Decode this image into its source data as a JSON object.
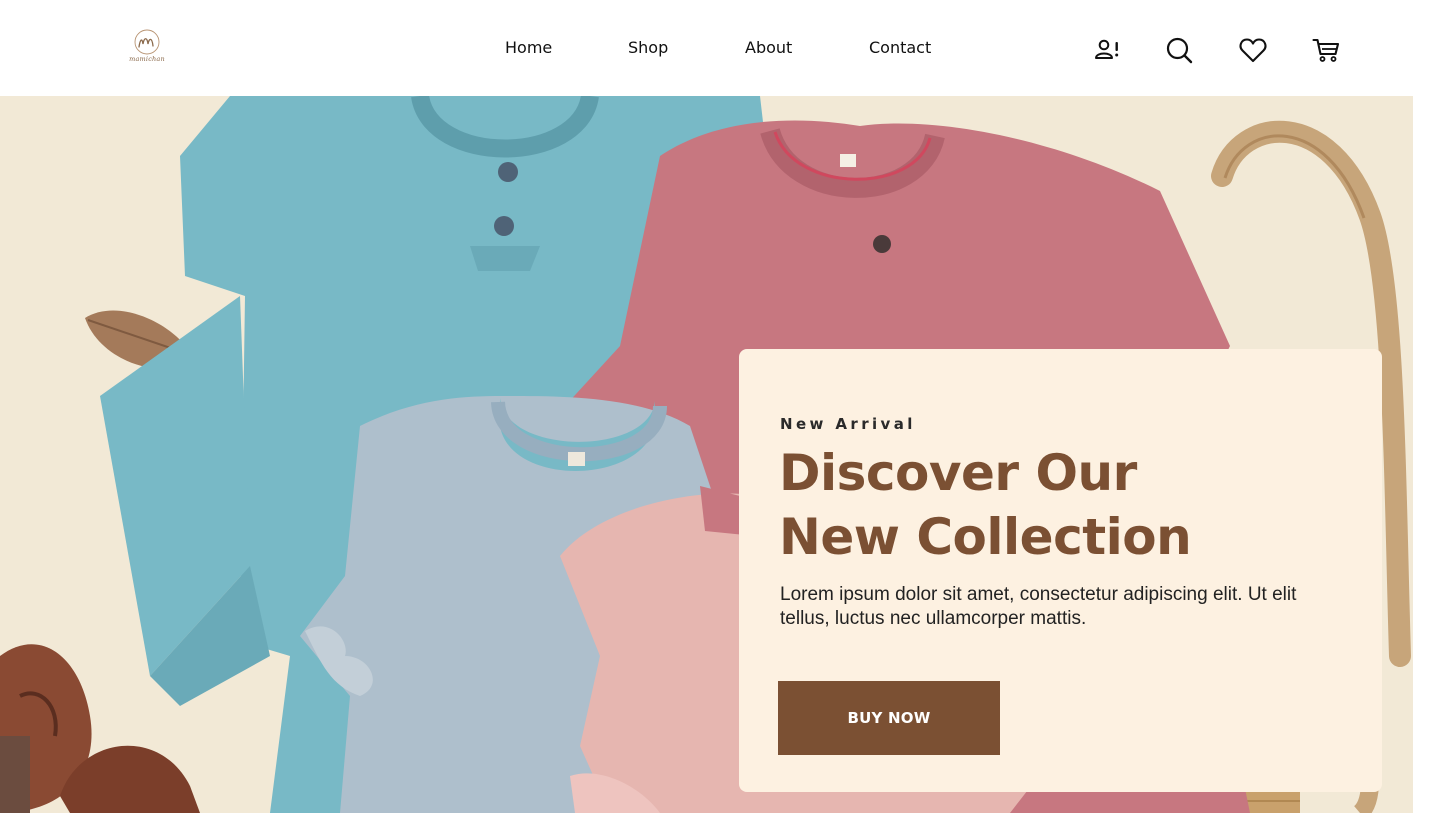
{
  "brand": {
    "logo_icon": "monogram-m-logo",
    "logo_text": "mamichan"
  },
  "nav": {
    "items": [
      {
        "label": "Home"
      },
      {
        "label": "Shop"
      },
      {
        "label": "About"
      },
      {
        "label": "Contact"
      }
    ]
  },
  "header_icons": [
    {
      "name": "user-account-icon"
    },
    {
      "name": "search-icon"
    },
    {
      "name": "heart-icon"
    },
    {
      "name": "cart-icon"
    }
  ],
  "hero": {
    "eyebrow": "New Arrival",
    "headline_line1": "Discover Our",
    "headline_line2": "New Collection",
    "description": "Lorem ipsum dolor sit amet, consectetur adipiscing elit. Ut elit tellus, luctus nec ullamcorper mattis.",
    "cta_label": "BUY NOW",
    "background_image": "flat-lay-childrens-shirts-photo"
  },
  "colors": {
    "accent_brown": "#7b5033",
    "card_cream": "#fdf1e1",
    "hero_bg": "#f3ead8"
  }
}
